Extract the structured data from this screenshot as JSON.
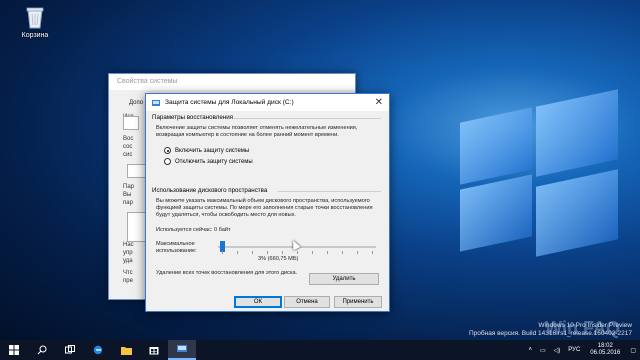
{
  "desktop": {
    "recycle_bin_label": "Корзина"
  },
  "back_window": {
    "title": "Свойства системы",
    "tab_label": "Допо",
    "side_texts": [
      "Исп",
      "Вос",
      "сос",
      "сис",
      "Пар",
      "Вы",
      "пар",
      "Нас",
      "упр",
      "уда",
      "Чтс",
      "пре"
    ]
  },
  "dialog": {
    "title": "Защита системы для Локальный диск (C:)",
    "restore_group_label": "Параметры восстановления",
    "restore_description": "Включение защиты системы позволяет отменять нежелательные изменения, возвращая компьютер в состояние на более ранний момент времени.",
    "radio_enable": "Включить защиту системы",
    "radio_disable": "Отключить защиту системы",
    "selected_radio": "enable",
    "disk_group_label": "Использование дискового пространства",
    "disk_description": "Вы можете указать максимальный объем дискового пространства, используемого функцией защиты системы. По мере его заполнения старые точки восстановления будут удаляться, чтобы освободить место для новых.",
    "current_usage": "Используется сейчас:   0 байт",
    "max_usage_label": "Максимальное использование:",
    "max_usage_value": "3% (660,75 МБ)",
    "max_usage_percent": 3,
    "delete_description": "Удаление всех точек восстановления для этого диска.",
    "delete_button": "Удалить",
    "ok_button": "ОК",
    "cancel_button": "Отмена",
    "apply_button": "Применить"
  },
  "watermark": {
    "line1": "Windows 10 Pro Insider Preview",
    "line2": "Пробная версия. Build 14316.rs1_release.160402-2217",
    "faq": "Win FAQ"
  },
  "taskbar": {
    "language": "РУС",
    "time": "18:02",
    "date": "06.05.2016",
    "items": [
      "start-icon",
      "search-icon",
      "task-view-icon",
      "edge-icon",
      "explorer-icon",
      "store-icon",
      "system-protection-icon"
    ]
  },
  "colors": {
    "accent": "#0078d7",
    "desktop": "#0a3f86"
  }
}
